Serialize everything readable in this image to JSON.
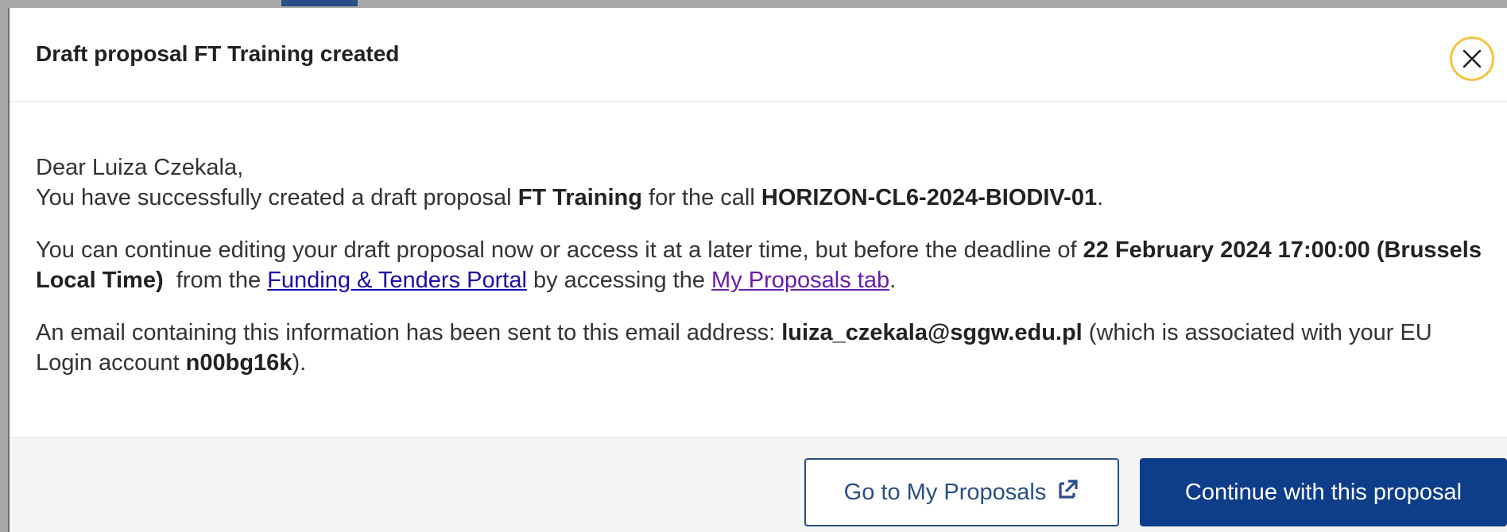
{
  "dialog": {
    "title": "Draft proposal FT Training created",
    "close_icon": "close-icon",
    "accent_color": "#0e3d8a",
    "focus_ring_color": "#f5c242"
  },
  "message": {
    "greeting": "Dear Luiza Czekala,",
    "line1_prefix": "You have successfully created a draft proposal ",
    "proposal_name": "FT Training",
    "line1_middle": " for the call ",
    "call_id": "HORIZON-CL6-2024-BIODIV-01",
    "line1_suffix": ".",
    "line2_prefix": "You can continue editing your draft proposal now or access it at a later time, but before the deadline of ",
    "deadline": "22 February 2024 17:00:00 (Brussels Local Time)",
    "line2_middle": "  from the ",
    "portal_link": "Funding & Tenders Portal",
    "line2_middle2": " by accessing the ",
    "proposals_tab_link": "My Proposals tab",
    "line2_suffix": ".",
    "line3_prefix": "An email containing this information has been sent to this email address: ",
    "email": "luiza_czekala@sggw.edu.pl",
    "line3_middle": " (which is associated with your EU Login account ",
    "eu_login": "n00bg16k",
    "line3_suffix": ")."
  },
  "footer": {
    "go_to_proposals_label": "Go to My Proposals",
    "external_link_icon": "external-link-icon",
    "continue_label": "Continue with this proposal"
  }
}
